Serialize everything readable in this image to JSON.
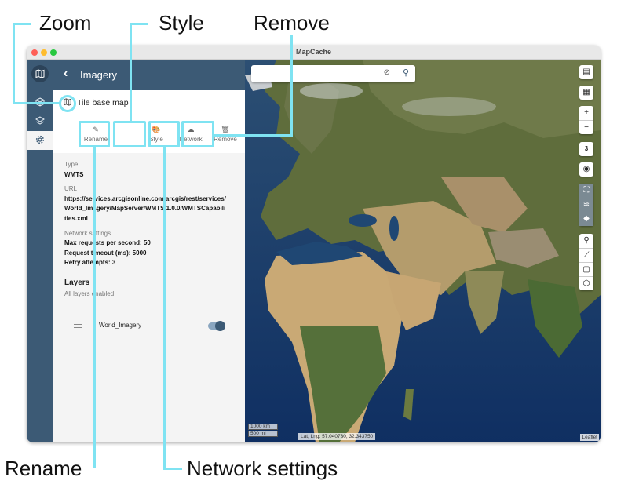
{
  "callouts": {
    "zoom": "Zoom",
    "style": "Style",
    "remove": "Remove",
    "rename": "Rename",
    "network_settings": "Network settings"
  },
  "window": {
    "title": "MapCache"
  },
  "rail": {
    "logo_icon": "map-logo-icon",
    "items": [
      {
        "icon": "cube-icon"
      },
      {
        "icon": "layers-icon"
      },
      {
        "icon": "gear-icon",
        "active": true
      }
    ]
  },
  "panel": {
    "back_icon": "chevron-left-icon",
    "title": "Imagery",
    "source": {
      "icon": "map-icon",
      "name": "Tile base map",
      "actions": {
        "rename": "Rename",
        "style": "Style",
        "network": "Network",
        "remove": "Remove"
      }
    },
    "details": {
      "type_label": "Type",
      "type_value": "WMTS",
      "url_label": "URL",
      "url_line1": "https://services.arcgisonline.com/arcgis/rest/services/",
      "url_line2": "World_Imagery/MapServer/WMTS/1.0.0/WMTSCapabili",
      "url_line3": "ties.xml",
      "network_label": "Network settings",
      "max_requests": "Max requests per second: 50",
      "timeout": "Request timeout (ms): 5000",
      "retry": "Retry attempts: 3"
    },
    "layers": {
      "heading": "Layers",
      "subtitle": "All layers enabled",
      "items": [
        {
          "name": "World_Imagery",
          "enabled": true
        }
      ]
    }
  },
  "map": {
    "search": {
      "value": "",
      "clear_icon": "map-off-icon",
      "search_icon": "search-icon"
    },
    "controls": {
      "zoom_in": "+",
      "zoom_out": "−",
      "zoom_level": "3"
    },
    "scale_km": "1000 km",
    "scale_mi": "500 mi",
    "coords": "Lat, Lng: 57.040730, 32.343750",
    "attribution": "Leaflet"
  },
  "colors": {
    "accent": "#3c5a75",
    "highlight": "#7fe3f2"
  }
}
